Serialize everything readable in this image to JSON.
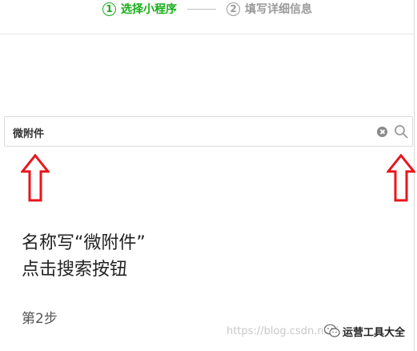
{
  "stepper": {
    "steps": [
      {
        "number": "1",
        "label": "选择小程序",
        "active": true
      },
      {
        "number": "2",
        "label": "填写详细信息",
        "active": false
      }
    ],
    "active_color": "#1aad19",
    "inactive_color": "#9a9a9a"
  },
  "search": {
    "value": "微附件",
    "clear_icon": "clear-icon",
    "search_icon": "search-icon"
  },
  "annotation": {
    "line1": "名称写“微附件”",
    "line2": "点击搜索按钮",
    "step": "第2步",
    "arrow_color": "#e8151b"
  },
  "watermark": {
    "url_text": "https://blog.csdn.net/...",
    "channel": "运营工具大全"
  }
}
